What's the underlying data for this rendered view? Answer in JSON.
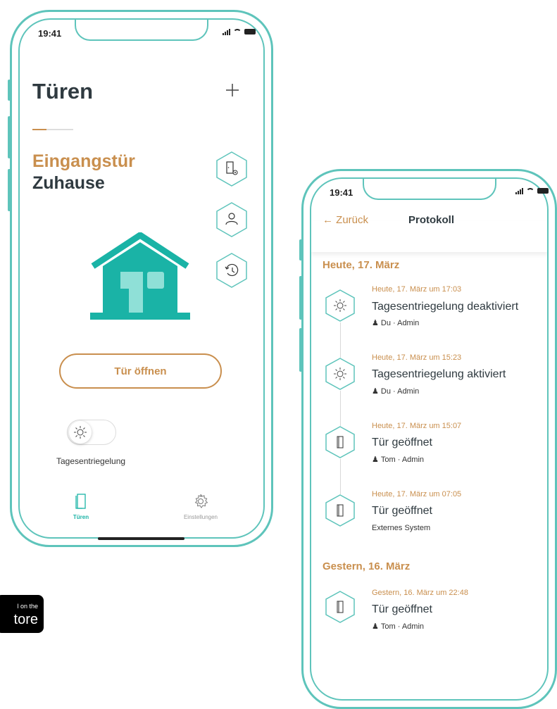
{
  "colors": {
    "accent_teal": "#5ec4bb",
    "house_teal": "#1ab3a6",
    "accent_gold": "#c98f4e",
    "text_dark": "#2f3a40"
  },
  "left_phone": {
    "status_time": "19:41",
    "title": "Türen",
    "add_icon": "plus-icon",
    "door_name": "Eingangstür",
    "door_location": "Zuhause",
    "side_actions": [
      {
        "icon": "door-settings-icon"
      },
      {
        "icon": "user-icon"
      },
      {
        "icon": "history-icon"
      }
    ],
    "open_button": "Tür öffnen",
    "toggle_label": "Tagesentriegelung",
    "tabs": [
      {
        "label": "Türen",
        "icon": "doors-icon",
        "active": true
      },
      {
        "label": "Einstellungen",
        "icon": "gear-icon",
        "active": false
      }
    ]
  },
  "store_badge": {
    "small": "l on the",
    "big": "tore"
  },
  "right_phone": {
    "status_time": "19:41",
    "back_label": "Zurück",
    "title": "Protokoll",
    "sections": [
      {
        "heading": "Heute, 17. März",
        "entries": [
          {
            "time": "Heute, 17. März um 17:03",
            "title": "Tagesentriegelung deaktiviert",
            "user": "Du · Admin",
            "icon": "sun-icon"
          },
          {
            "time": "Heute, 17. März um 15:23",
            "title": "Tagesentriegelung aktiviert",
            "user": "Du · Admin",
            "icon": "sun-icon"
          },
          {
            "time": "Heute, 17. März um 15:07",
            "title": "Tür geöffnet",
            "user": "Tom · Admin",
            "icon": "door-icon"
          },
          {
            "time": "Heute, 17. März um 07:05",
            "title": "Tür geöffnet",
            "user": "Externes System",
            "icon": "door-icon"
          }
        ]
      },
      {
        "heading": "Gestern, 16. März",
        "entries": [
          {
            "time": "Gestern, 16. März um 22:48",
            "title": "Tür geöffnet",
            "user": "Tom · Admin",
            "icon": "door-icon"
          }
        ]
      }
    ]
  }
}
